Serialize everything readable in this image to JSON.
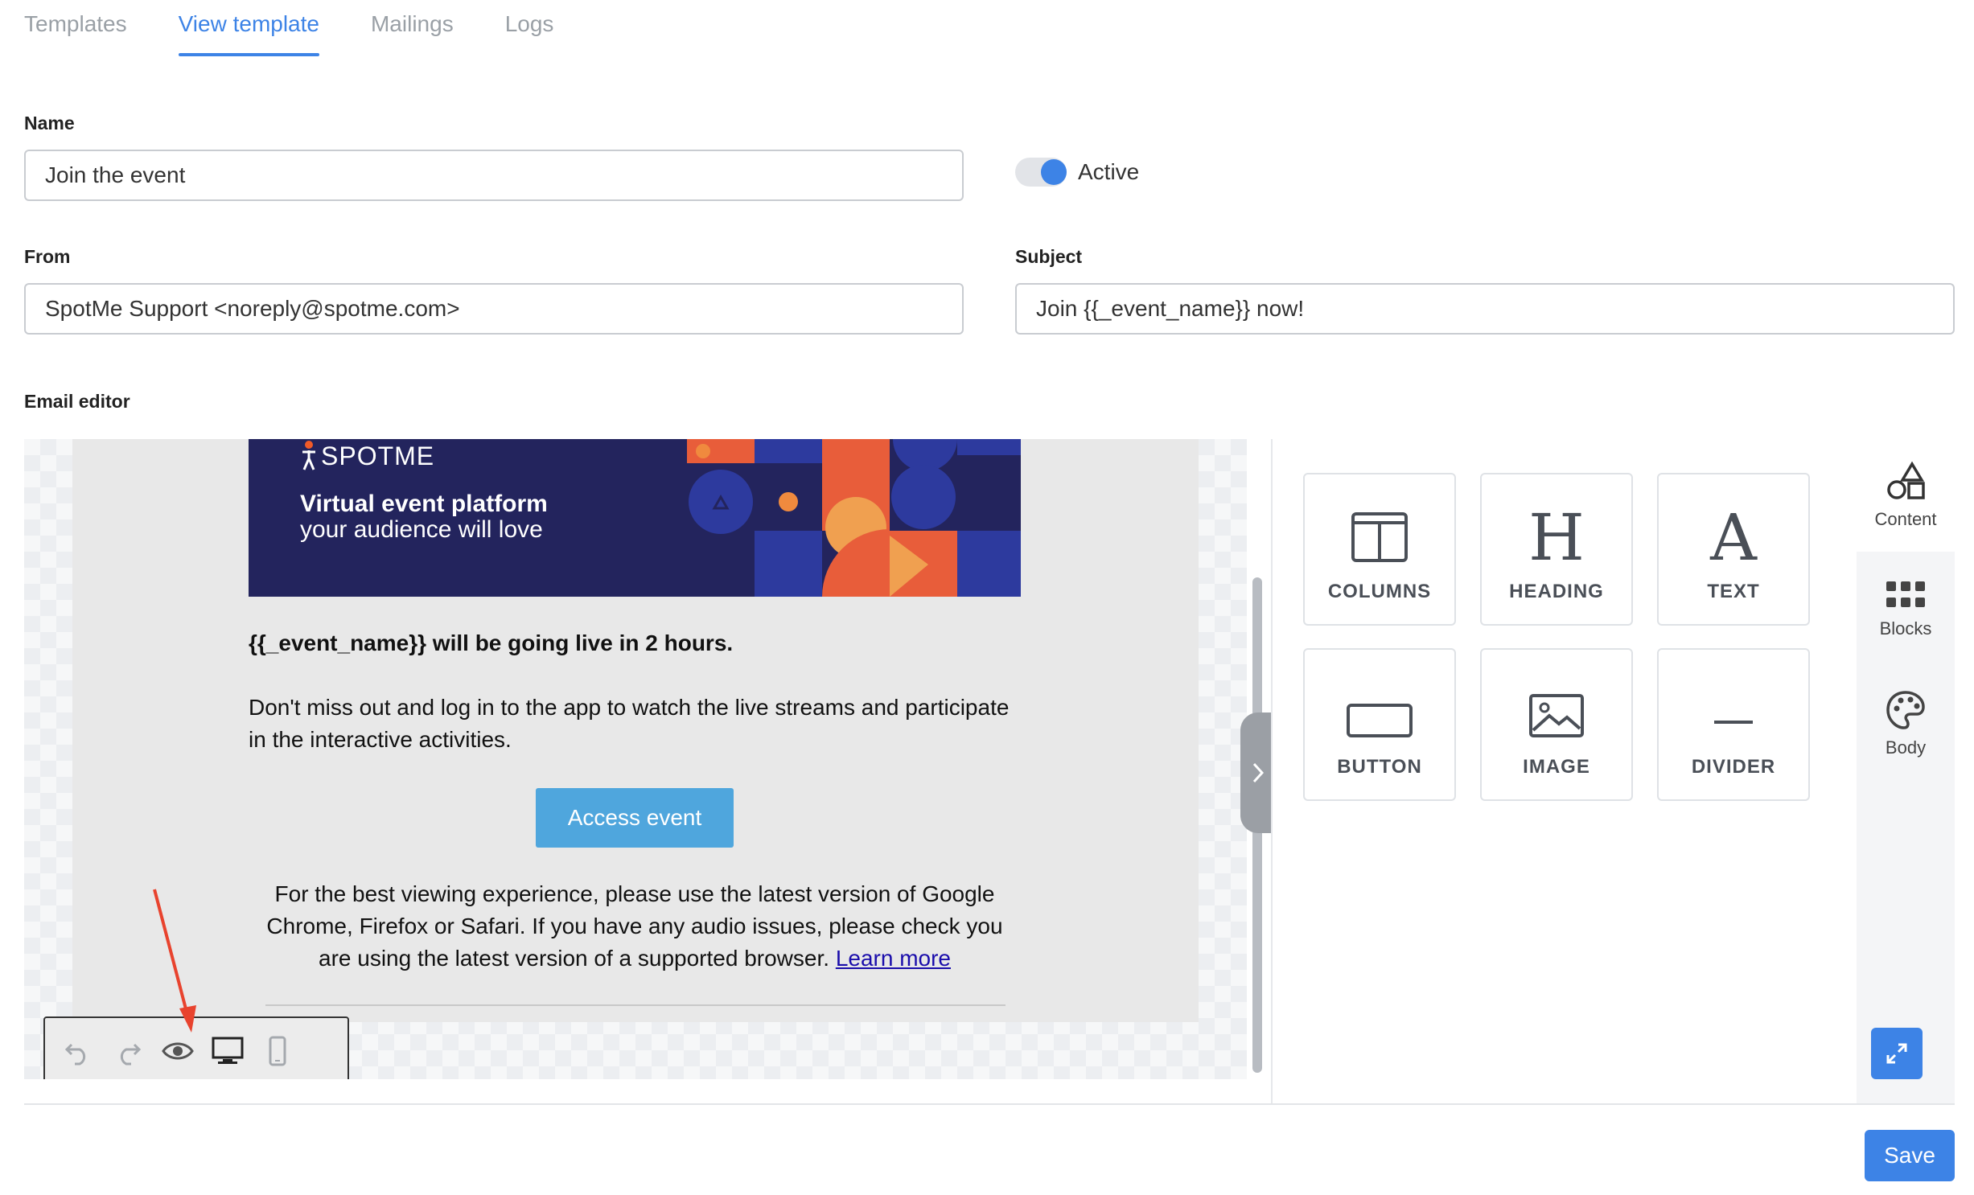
{
  "tabs": [
    {
      "label": "Templates"
    },
    {
      "label": "View template"
    },
    {
      "label": "Mailings"
    },
    {
      "label": "Logs"
    }
  ],
  "form": {
    "name_label": "Name",
    "name_value": "Join the event",
    "active_label": "Active",
    "active_on": true,
    "from_label": "From",
    "from_value": "SpotMe Support <noreply@spotme.com>",
    "subject_label": "Subject",
    "subject_value": "Join {{_event_name}} now!",
    "editor_label": "Email editor"
  },
  "email": {
    "logo_text": "SPOTME",
    "banner_title": "Virtual event platform",
    "banner_subtitle": "your audience will love",
    "heading": "{{_event_name}} will be going live in 2 hours.",
    "body": "Don't miss out and log in to the app to watch the live streams and participate in the interactive activities.",
    "button_label": "Access event",
    "note": "For the best viewing experience, please use the latest version of Google Chrome, Firefox or Safari. If you have any audio issues, please check you are using the latest version of a supported browser.",
    "note_link": "Learn more"
  },
  "toolbar": {
    "icons": [
      "undo-icon",
      "redo-icon",
      "preview-eye-icon",
      "desktop-icon",
      "mobile-icon"
    ]
  },
  "content_tiles": [
    {
      "label": "COLUMNS",
      "icon": "columns-icon"
    },
    {
      "label": "HEADING",
      "icon": "heading-icon"
    },
    {
      "label": "TEXT",
      "icon": "text-icon"
    },
    {
      "label": "BUTTON",
      "icon": "button-icon"
    },
    {
      "label": "IMAGE",
      "icon": "image-icon"
    },
    {
      "label": "DIVIDER",
      "icon": "divider-icon"
    }
  ],
  "sidebar": {
    "items": [
      {
        "label": "Content",
        "icon": "shapes-icon"
      },
      {
        "label": "Blocks",
        "icon": "grid-icon"
      },
      {
        "label": "Body",
        "icon": "palette-icon"
      }
    ]
  },
  "actions": {
    "save_label": "Save"
  },
  "colors": {
    "accent": "#3d83e6",
    "banner_bg": "#23245d",
    "email_button": "#4fa6dd",
    "annotation_arrow": "#e8432e"
  }
}
